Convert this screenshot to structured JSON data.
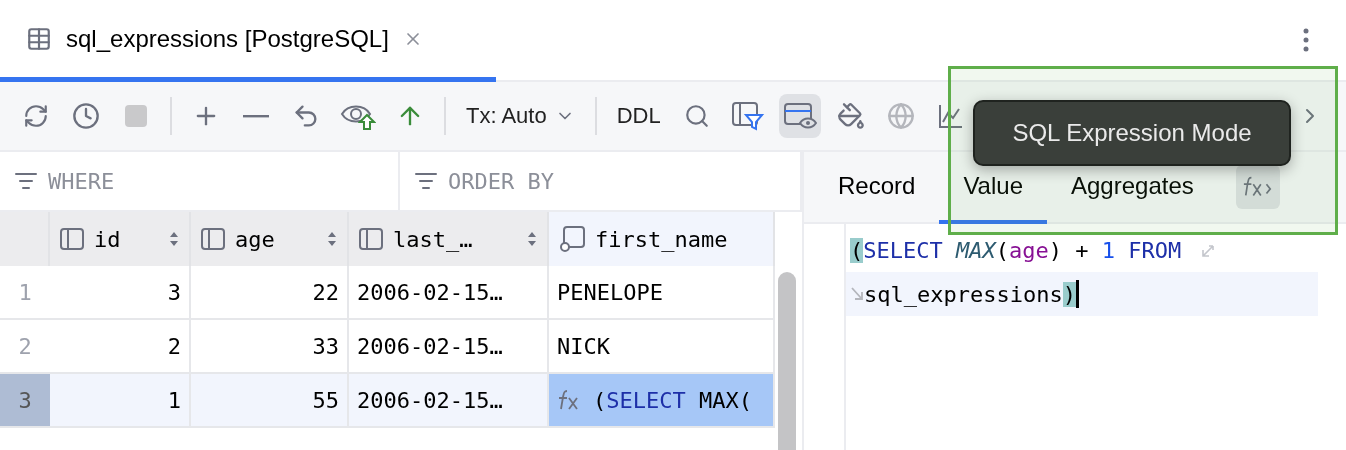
{
  "editor_tab": {
    "title": "sql_expressions [PostgreSQL]",
    "selected": true
  },
  "toolbar": {
    "tx_dropdown": "Tx: Auto",
    "ddl_button": "DDL",
    "expression_mode": {
      "selected": true
    }
  },
  "filter": {
    "where_placeholder": "WHERE",
    "order_by_placeholder": "ORDER BY"
  },
  "table": {
    "columns": [
      {
        "name": "id",
        "kind": "column",
        "sortable": true
      },
      {
        "name": "age",
        "kind": "column",
        "sortable": true
      },
      {
        "name": "last_…",
        "kind": "column",
        "sortable": true
      },
      {
        "name": "first_name",
        "kind": "modified",
        "sortable": false
      }
    ],
    "rows": [
      {
        "number": "1",
        "selected": false,
        "cells": [
          {
            "kind": "number",
            "text": "3",
            "focused": false
          },
          {
            "kind": "number",
            "text": "22",
            "focused": false
          },
          {
            "kind": "text",
            "text": "2006-02-15…",
            "focused": false
          },
          {
            "kind": "text",
            "text": "PENELOPE",
            "focused": false
          }
        ]
      },
      {
        "number": "2",
        "selected": false,
        "cells": [
          {
            "kind": "number",
            "text": "2",
            "focused": false
          },
          {
            "kind": "number",
            "text": "33",
            "focused": false
          },
          {
            "kind": "text",
            "text": "2006-02-15…",
            "focused": false
          },
          {
            "kind": "text",
            "text": "NICK",
            "focused": false
          }
        ]
      },
      {
        "number": "3",
        "selected": true,
        "cells": [
          {
            "kind": "number",
            "text": "1",
            "focused": false
          },
          {
            "kind": "number",
            "text": "55",
            "focused": false
          },
          {
            "kind": "text",
            "text": "2006-02-15…",
            "focused": false
          },
          {
            "kind": "expression",
            "focused": true,
            "tokens": [
              {
                "kind": "punct",
                "text": "("
              },
              {
                "kind": "keyword",
                "text": "SELECT"
              },
              {
                "kind": "punct",
                "text": " MAX("
              }
            ]
          }
        ]
      }
    ]
  },
  "side_panel": {
    "tabs": [
      {
        "label": "Record",
        "selected": false
      },
      {
        "label": "Value",
        "selected": true
      },
      {
        "label": "Aggregates",
        "selected": false
      }
    ],
    "editor_lines": [
      {
        "current": false,
        "wrap_out": true,
        "wrap_in": false,
        "tokens": [
          {
            "kind": "punct",
            "text": "(",
            "matched": true
          },
          {
            "kind": "keyword",
            "text": "SELECT ",
            "matched": false
          },
          {
            "kind": "function",
            "text": "MAX",
            "matched": false
          },
          {
            "kind": "punct",
            "text": "(",
            "matched": false
          },
          {
            "kind": "column",
            "text": "age",
            "matched": false
          },
          {
            "kind": "punct",
            "text": ") + ",
            "matched": false
          },
          {
            "kind": "number",
            "text": "1 ",
            "matched": false
          },
          {
            "kind": "keyword",
            "text": "FROM",
            "matched": false
          }
        ]
      },
      {
        "current": true,
        "wrap_out": false,
        "wrap_in": true,
        "tokens": [
          {
            "kind": "punct",
            "text": "sql_expressions",
            "matched": false
          },
          {
            "kind": "punct",
            "text": ")",
            "matched": true
          }
        ]
      }
    ]
  },
  "tooltip": {
    "text": "SQL Expression Mode"
  }
}
